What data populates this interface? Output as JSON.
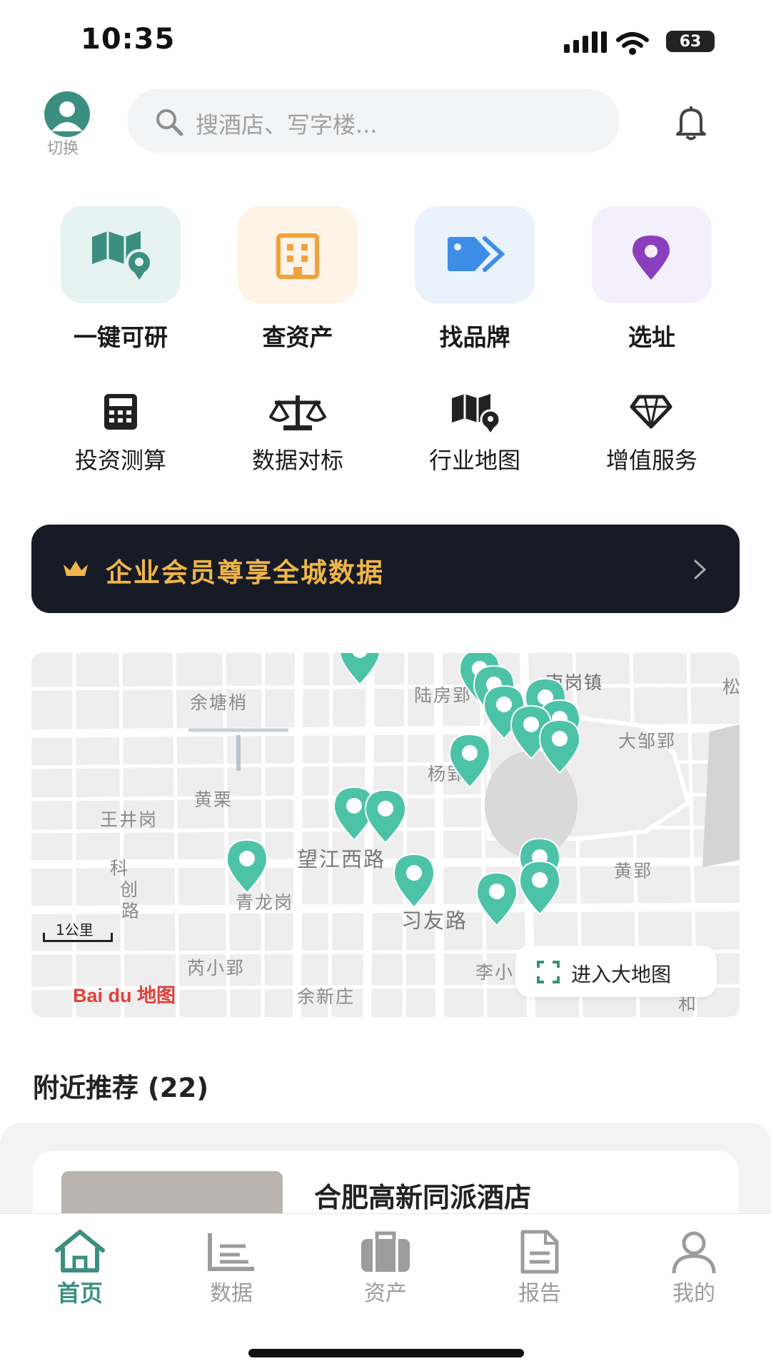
{
  "status_bar": {
    "time": "10:35",
    "battery": "63"
  },
  "header": {
    "switch_label": "切换",
    "search_placeholder": "搜酒店、写字楼..."
  },
  "quick_tiles": [
    {
      "label": "一键可研",
      "icon": "map-pin-icon",
      "color": "#3c8f80"
    },
    {
      "label": "查资产",
      "icon": "building-icon",
      "color": "#f0a23c"
    },
    {
      "label": "找品牌",
      "icon": "tag-icon",
      "color": "#3f8ee6"
    },
    {
      "label": "选址",
      "icon": "location-pin-icon",
      "color": "#8b3fbf"
    }
  ],
  "tools": [
    {
      "label": "投资测算",
      "icon": "calculator-icon"
    },
    {
      "label": "数据对标",
      "icon": "scale-icon"
    },
    {
      "label": "行业地图",
      "icon": "map-icon"
    },
    {
      "label": "增值服务",
      "icon": "diamond-icon"
    }
  ],
  "banner": {
    "text": "企业会员尊享全城数据",
    "accent": "#f0b549"
  },
  "map": {
    "labels": [
      "余塘梢",
      "陆房郢",
      "南岗镇",
      "大邹郢",
      "杨郢",
      "黄栗",
      "王井岗",
      "科",
      "创",
      "路",
      "望江西路",
      "青龙岗",
      "习友路",
      "黄郢",
      "芮小郢",
      "余新庄",
      "李小",
      "松",
      "和"
    ],
    "scale": "1公里",
    "logo": "Bai du 地图",
    "enter_button": "进入大地图",
    "marker_color": "#4cc3a7"
  },
  "nearby": {
    "title": "附近推荐 (22)",
    "first_item": "合肥高新同派酒店"
  },
  "tabbar": [
    {
      "label": "首页",
      "icon": "home-icon",
      "active": true
    },
    {
      "label": "数据",
      "icon": "chart-icon",
      "active": false
    },
    {
      "label": "资产",
      "icon": "briefcase-icon",
      "active": false
    },
    {
      "label": "报告",
      "icon": "document-icon",
      "active": false
    },
    {
      "label": "我的",
      "icon": "user-icon",
      "active": false
    }
  ],
  "active_color": "#3c8f80"
}
